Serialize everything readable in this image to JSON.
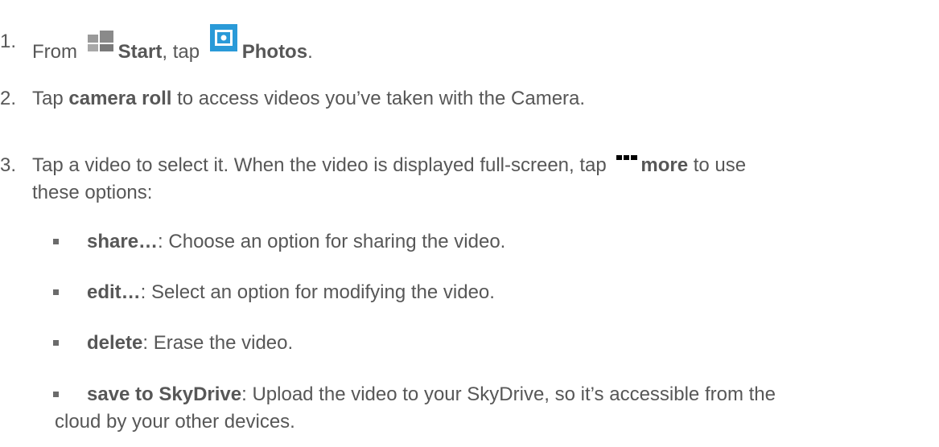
{
  "steps": [
    {
      "num": "1.",
      "pre": "From",
      "start_label": "Start",
      "mid": ", tap",
      "photos_label": "Photos",
      "end": ".",
      "start_icon": "windows-start-icon",
      "photos_icon": "photos-app-icon",
      "photos_icon_color": "#2a9ad8"
    },
    {
      "num": "2.",
      "pre": "Tap",
      "bold": "camera roll",
      "post": "to access videos you’ve taken with the Camera."
    },
    {
      "num": "3.",
      "line1_pre": "Tap a video to select it. When the video is displayed full-screen, tap",
      "more_icon": "more-dots-icon",
      "more_label": "more",
      "line1_post": "to use",
      "line2": "these options:"
    }
  ],
  "options": [
    {
      "label": "share…",
      "desc": ": Choose an option for sharing the video."
    },
    {
      "label": "edit…",
      "desc": ": Select an option for modifying the video."
    },
    {
      "label": "delete",
      "desc": ": Erase the video."
    },
    {
      "label": "save to SkyDrive",
      "desc": ": Upload the video to your SkyDrive, so it’s accessible from the",
      "desc_line2": "cloud by your other devices."
    }
  ]
}
